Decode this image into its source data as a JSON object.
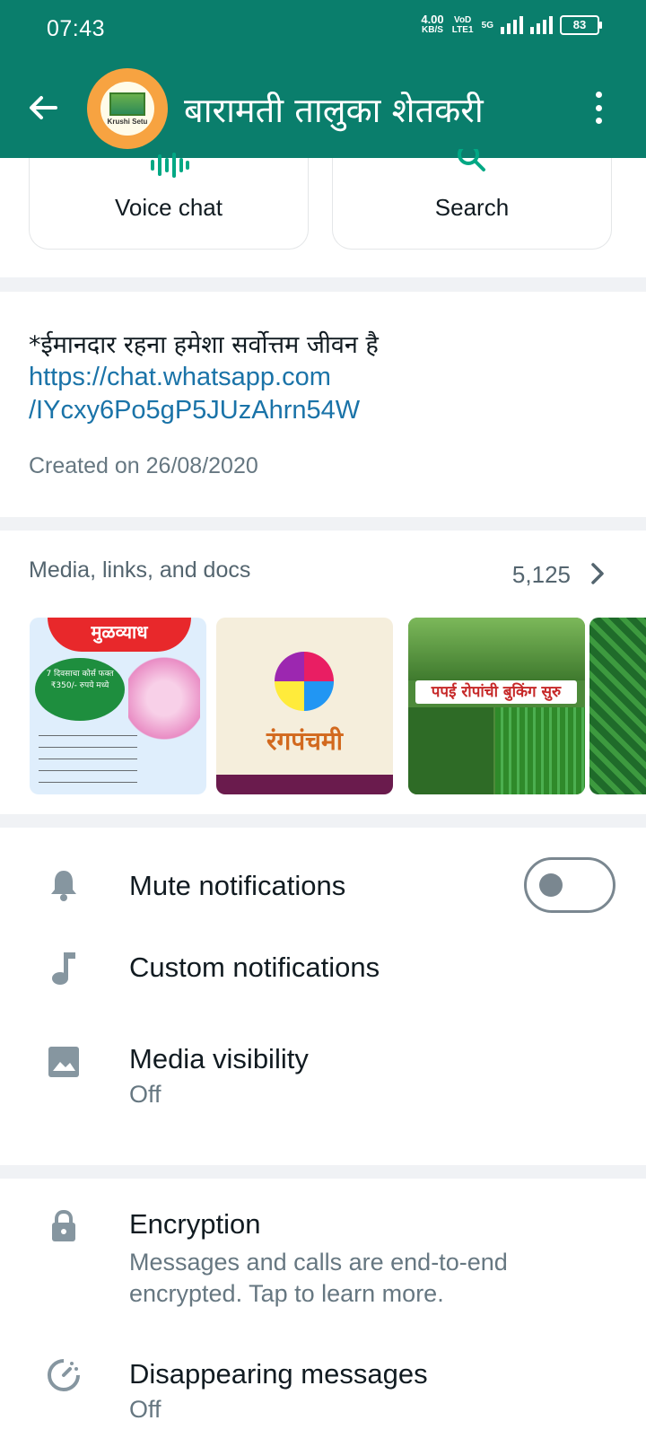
{
  "status_bar": {
    "time": "07:43",
    "net_speed_value": "4.00",
    "net_speed_unit": "KB/S",
    "volte": "VoD LTE1",
    "network": "5G",
    "battery": "83"
  },
  "header": {
    "title": "बारामती तालुका शेतकरी",
    "avatar_text": "Krushi Setu"
  },
  "actions": {
    "voice_chat_label": "Voice chat",
    "search_label": "Search"
  },
  "description": {
    "text": "*ईमानदार रहना हमेशा सर्वोत्तम जीवन है",
    "link_line1": "https://chat.whatsapp.com",
    "link_line2": "/IYcxy6Po5gP5JUzAhrn54W",
    "created": "Created on 26/08/2020"
  },
  "media": {
    "title": "Media, links, and docs",
    "count": "5,125",
    "thumbnails": [
      {
        "name": "mulvyadh-poster",
        "text": "मुळव्याध",
        "sub": "7 दिवसाचा कोर्स फक्त ₹350/- रुपये मध्ये"
      },
      {
        "name": "rangpanchami-poster",
        "text": "रंगपंचमी"
      },
      {
        "name": "papaya-poster",
        "text": "पपई रोपांची बुकिंग सुरु"
      },
      {
        "name": "nursery-photo"
      }
    ]
  },
  "settings": {
    "mute_label": "Mute notifications",
    "mute_on": false,
    "custom_label": "Custom notifications",
    "media_vis_label": "Media visibility",
    "media_vis_value": "Off",
    "encryption_label": "Encryption",
    "encryption_sub_line1": "Messages and calls are end-to-end",
    "encryption_sub_line2": "encrypted. Tap to learn more.",
    "disappearing_label": "Disappearing messages",
    "disappearing_value": "Off"
  },
  "colors": {
    "header_bg": "#0a7e6c",
    "link": "#1a73a8",
    "accent": "#00a884"
  }
}
